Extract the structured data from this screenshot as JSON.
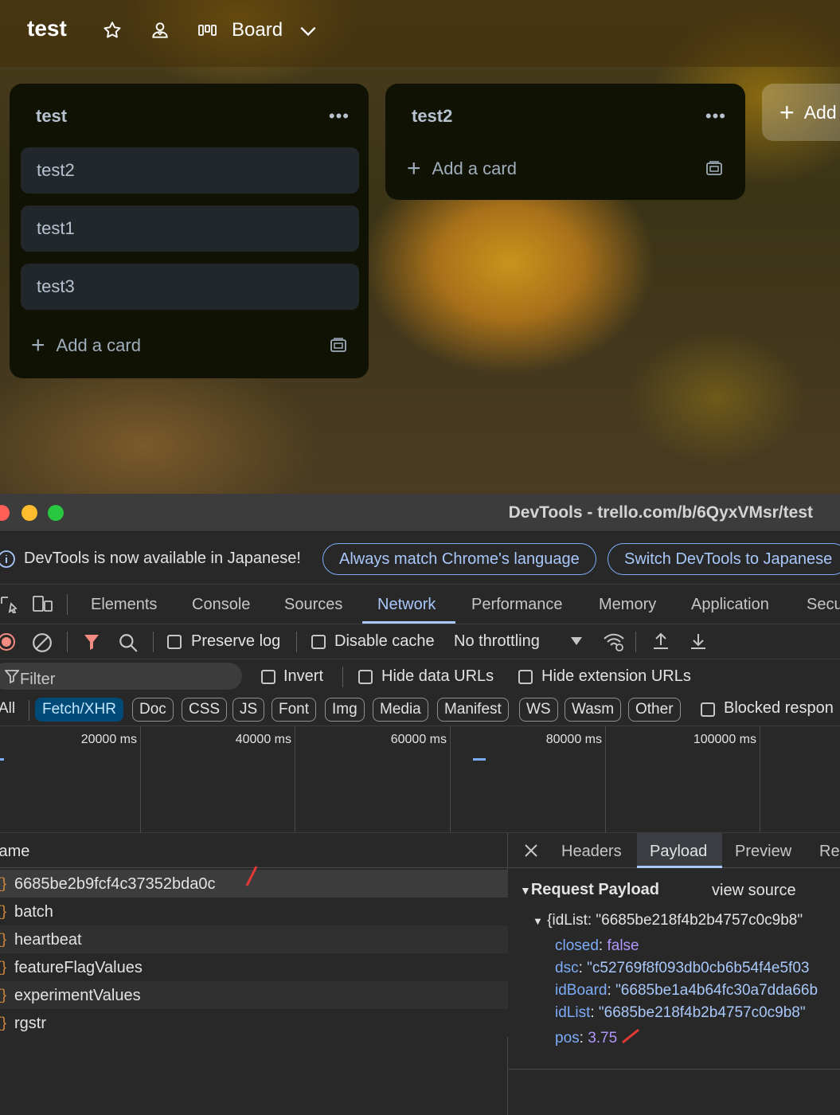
{
  "board": {
    "title": "test",
    "view_label": "Board",
    "add_list_label": "Add"
  },
  "lists": [
    {
      "title": "test",
      "cards": [
        "test2",
        "test1",
        "test3"
      ],
      "add_card_label": "Add a card"
    },
    {
      "title": "test2",
      "cards": [],
      "add_card_label": "Add a card"
    }
  ],
  "devtools": {
    "window_title": "DevTools - trello.com/b/6QyxVMsr/test",
    "infobar": {
      "message": "DevTools is now available in Japanese!",
      "btn_match": "Always match Chrome's language",
      "btn_switch": "Switch DevTools to Japanese"
    },
    "tabs": [
      "Elements",
      "Console",
      "Sources",
      "Network",
      "Performance",
      "Memory",
      "Application",
      "Secu"
    ],
    "active_tab": "Network",
    "toolbar": {
      "preserve_log": "Preserve log",
      "disable_cache": "Disable cache",
      "throttling": "No throttling"
    },
    "filterbar": {
      "filter_placeholder": "Filter",
      "invert": "Invert",
      "hide_data_urls": "Hide data URLs",
      "hide_ext_urls": "Hide extension URLs"
    },
    "type_filters": [
      "All",
      "Fetch/XHR",
      "Doc",
      "CSS",
      "JS",
      "Font",
      "Img",
      "Media",
      "Manifest",
      "WS",
      "Wasm",
      "Other"
    ],
    "active_type": "Fetch/XHR",
    "blocked_label": "Blocked respon",
    "timeline_labels": [
      "20000 ms",
      "40000 ms",
      "60000 ms",
      "80000 ms",
      "100000 ms"
    ],
    "request_list": {
      "header": "lame",
      "rows": [
        "6685be2b9fcf4c37352bda0c",
        "batch",
        "heartbeat",
        "featureFlagValues",
        "experimentValues",
        "rgstr"
      ]
    },
    "detail": {
      "tabs": [
        "Headers",
        "Payload",
        "Preview",
        "Re"
      ],
      "active_tab": "Payload",
      "section_title": "Request Payload",
      "view_source": "view source",
      "summary": "{idList: \"6685be218f4b2b4757c0c9b8\"",
      "fields": {
        "closed_key": "closed",
        "closed_val": "false",
        "dsc_key": "dsc",
        "dsc_val": "\"c52769f8f093db0cb6b54f4e5f03",
        "idBoard_key": "idBoard",
        "idBoard_val": "\"6685be1a4b64fc30a7dda66b",
        "idList_key": "idList",
        "idList_val": "\"6685be218f4b2b4757c0c9b8\"",
        "pos_key": "pos",
        "pos_val": "3.75"
      }
    }
  }
}
